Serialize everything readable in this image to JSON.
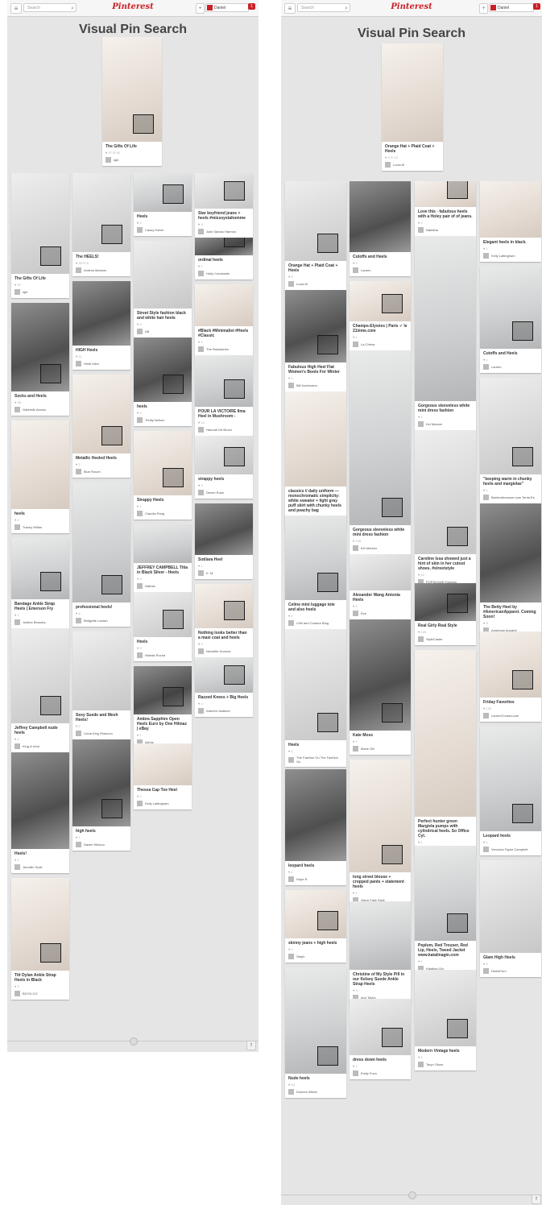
{
  "search_placeholder": "Search",
  "logo": "Pinterest",
  "page_title": "Visual Pin Search",
  "plus_icon": "+",
  "left": {
    "user": "Daniel",
    "notifications": "1",
    "source_pin": {
      "desc": "The Gifts Of Life",
      "meta": "♥ 37  ⟳ 52",
      "by": "iqbl"
    },
    "pins": [
      {
        "desc": "The Gifts Of Life",
        "meta": "♥ 37",
        "by": "iqbl"
      },
      {
        "desc": "Socks and Heels",
        "meta": "♥ 38",
        "by": "Gabrielle Alonso"
      },
      {
        "desc": "heels",
        "meta": "♥ 2",
        "by": "Tracey Willan"
      },
      {
        "desc": "Bandage Ankle Strap Heels | Emerson Fry",
        "meta": "♥ 1",
        "by": "Justine Beaudry"
      },
      {
        "desc": "Jeffrey Campbell nude heels",
        "meta": "♥ 1",
        "by": "King & Kind"
      },
      {
        "desc": "Heels!",
        "meta": "♥ 1",
        "by": "Jennifer Scott"
      },
      {
        "desc": "Titt Dylan Ankle Strap Heels in Black",
        "meta": "♥ 3",
        "by": "BOYD.CO"
      },
      {
        "desc": "The HEELS!",
        "meta": "♥ 45  ⟳ 6",
        "by": "Andrea Marinon"
      },
      {
        "desc": "HIGH Heels",
        "meta": "♥ 11",
        "by": "Heidi Ultra"
      },
      {
        "desc": "Metallic Heeled Heels",
        "meta": "♥ 2",
        "by": "Blue Rouch"
      },
      {
        "desc": "professional heels!",
        "meta": "♥ 4",
        "by": "Bridgette Lauran"
      },
      {
        "desc": "Sexy Suede and Mesh Heels!",
        "meta": "♥ 2",
        "by": "Linda King Shavnon"
      },
      {
        "desc": "high heels",
        "meta": "♥ 1",
        "by": "Daniel Winson"
      },
      {
        "desc": "Heels",
        "meta": "♥ 2",
        "by": "Casey Kober"
      },
      {
        "desc": "Street Style fashion black and white hair heels",
        "meta": "♥ 4",
        "by": "AB"
      },
      {
        "desc": "heels",
        "meta": "♥ 1",
        "by": "Trinity Nelson"
      },
      {
        "desc": "Strappy Heels",
        "meta": "♥ 1",
        "by": "Claudia Pang"
      },
      {
        "desc": "JEFFREY CAMPBELL Titia in Black Silver - Heels",
        "meta": "♥ 3",
        "by": "Nathan"
      },
      {
        "desc": "Heels",
        "meta": "♥ 3",
        "by": "Wanda Rocha"
      },
      {
        "desc": "Ambra Sapphire Open Heels Euro by One Hilmaz | eBay",
        "meta": "♥ 1",
        "by": "Alexis"
      },
      {
        "desc": "Thessa Cap Toe Heel",
        "meta": "♥ 1",
        "by": "Kelly Lattingham"
      },
      {
        "desc": "Star boyfriend jeans + heels #misssystahomme",
        "meta": "♥ 4",
        "by": "Julie Santos Harmon"
      },
      {
        "desc": "ordinal heels",
        "meta": "♥ 1",
        "by": "Holly Constantin"
      },
      {
        "desc": "#Black #Minimalist #Heels #Classic",
        "meta": "♥ 1",
        "by": "The Rawstories"
      },
      {
        "desc": "POUR LA VICTOIRE Ilma Heel in Mushroom -",
        "meta": "♥ 14",
        "by": "Hannah De Bruch"
      },
      {
        "desc": "strappy heels",
        "meta": "♥ 3",
        "by": "Deven Rose"
      },
      {
        "desc": "Sotilara Heel",
        "meta": "♥ 1",
        "by": "K. M."
      },
      {
        "desc": "Nothing looks better than a maxi coat and heels",
        "meta": "♥ 9",
        "by": "Nicolette Konova"
      },
      {
        "desc": "Razzed Knees + Big Heels",
        "meta": "♥ 4",
        "by": "Kareem Vadhner"
      }
    ]
  },
  "right": {
    "user": "Daniel",
    "notifications": "1",
    "source_pin": {
      "desc": "Orange Hat + Plaid Coat + Heels",
      "meta": "♥ 5  ⟳ 13",
      "by": "Lucia M"
    },
    "pins": [
      {
        "desc": "Orange Hat + Plaid Coat + Heels",
        "meta": "♥ 5",
        "by": "Lucia M"
      },
      {
        "desc": "Fabulous High Heel Flat Women's Boots For Winter",
        "meta": "♥ 1",
        "by": "Bill Kurtzmann"
      },
      {
        "desc": "classics // daily uniform — monochromatic simplicity: white sweater + light gray puff skirt with chunky heels and peachy bag",
        "meta": "♥ 2",
        "by": "faded earth"
      },
      {
        "desc": "Celine mini luggage tote and also heels",
        "meta": "♥ 1",
        "by": "Chill and Couture Blog"
      },
      {
        "desc": "Heels",
        "meta": "♥ 1",
        "by": "The Fashion Ou The Fashion Ou"
      },
      {
        "desc": "leopard heels",
        "meta": "♥ 1",
        "by": "Hope R"
      },
      {
        "desc": "skinny jeans + high heels",
        "meta": "♥ 1",
        "by": "Steph"
      },
      {
        "desc": "Nude heels",
        "meta": "♥ 44",
        "by": "Dolores Wilner"
      },
      {
        "desc": "Cutoffs and Heels",
        "meta": "♥ 1",
        "by": "Lauren"
      },
      {
        "desc": "Champs-Elysées | Paris ✓ le 21ième.com",
        "meta": "♥ 1",
        "by": "La Chéna"
      },
      {
        "desc": "Gorgeous sleeveless white mini dress fashion",
        "meta": "♥ 105",
        "by": "Kel Mancer"
      },
      {
        "desc": "Alexander Wang Antonia Heels",
        "meta": "♥ 1",
        "by": "Eve"
      },
      {
        "desc": "Kate Moss",
        "meta": "♥ 1",
        "by": "Marie Gill"
      },
      {
        "desc": "long street blouse + cropped pants + statement heels",
        "meta": "♥ 1",
        "by": "Steve Falls Style"
      },
      {
        "desc": "Christine of My Style Pill in our Kelsey Suede Ankle Strap Heels",
        "meta": "♥ 3",
        "by": "Ann Taylor"
      },
      {
        "desc": "dress down heels",
        "meta": "♥ 1",
        "by": "Emily Foxa"
      },
      {
        "desc": "Love this - fabulous heels with a Holey pair of of jeans.",
        "meta": "♥ 2",
        "by": "Natasha"
      },
      {
        "desc": "Gorgeous sleeveless white mini dress fashion",
        "meta": "♥ 1",
        "by": "Kel Mancer"
      },
      {
        "desc": "Caroline Issa showed just a hint of skin in her cutout shoes. #streetstyle",
        "meta": "♥ 12",
        "by": "POPSUGAR Fashion"
      },
      {
        "desc": "Real Girly Real Style",
        "meta": "♥ 120",
        "by": "StyleCaster"
      },
      {
        "desc": "Perfect hunter green Margiela pumps with cylindrical heels. So Office Cyl.",
        "meta": "♥ 1",
        "by": "Shi Wylie"
      },
      {
        "desc": "Peplum, Red Trouser, Red Lip, Heels, Tweed Jacket www.katalinagin.com",
        "meta": "♥ 1",
        "by": "Katalina Gin"
      },
      {
        "desc": "Modern Vintage heels",
        "meta": "♥ 1",
        "by": "Taryn Olson"
      },
      {
        "desc": "Elegant heels in black.",
        "meta": "♥ 1",
        "by": "Kelly Lattingham"
      },
      {
        "desc": "Cutoffs and Heels",
        "meta": "♥ 1",
        "by": "Lauren"
      },
      {
        "desc": "\"keeping warm in chunky heels and margielas\"",
        "meta": "♥ 1",
        "by": "Bambolismouse.com Tenta Es"
      },
      {
        "desc": "The Betty Heel by #AmericanApparel. Coming Soon!",
        "meta": "♥ 8",
        "by": "American Apparel"
      },
      {
        "desc": "Friday Favorites",
        "meta": "♥ 132",
        "by": "LaurenConrad.com"
      },
      {
        "desc": "Leopard heels",
        "meta": "♥ 1",
        "by": "Veronica Taylor Campbell"
      },
      {
        "desc": "Glam High Heels",
        "meta": "♥ 4",
        "by": "HeelsPorn"
      }
    ]
  }
}
